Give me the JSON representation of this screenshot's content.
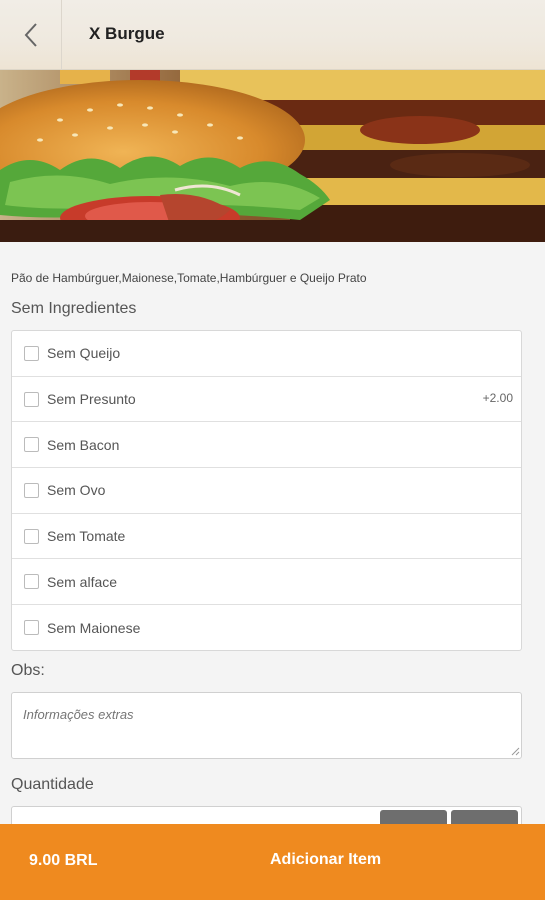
{
  "header": {
    "title": "X Burgue",
    "back_icon": "chevron-left-icon"
  },
  "product": {
    "description": "Pão de Hambúrguer,Maionese,Tomate,Hambúrguer e Queijo Prato"
  },
  "ingredients": {
    "section_title": "Sem Ingredientes",
    "items": [
      {
        "label": "Sem Queijo",
        "price": ""
      },
      {
        "label": "Sem Presunto",
        "price": "+2.00"
      },
      {
        "label": "Sem Bacon",
        "price": ""
      },
      {
        "label": "Sem Ovo",
        "price": ""
      },
      {
        "label": "Sem Tomate",
        "price": ""
      },
      {
        "label": "Sem alface",
        "price": ""
      },
      {
        "label": "Sem Maionese",
        "price": ""
      }
    ]
  },
  "obs": {
    "label": "Obs:",
    "placeholder": "Informações extras"
  },
  "quantity": {
    "label": "Quantidade"
  },
  "footer": {
    "price": "9.00 BRL",
    "add_button": "Adicionar Item"
  },
  "colors": {
    "accent": "#ef8a1f",
    "qty_button": "#6e6e6e"
  }
}
